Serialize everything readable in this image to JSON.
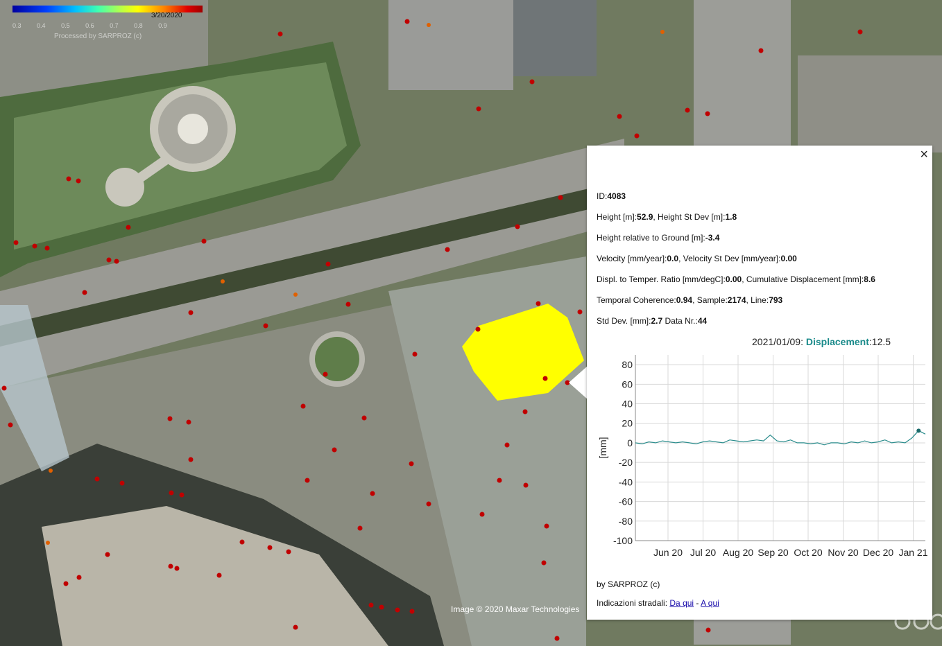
{
  "map": {
    "legend": {
      "date": "3/20/2020",
      "ticks": [
        "0.3",
        "0.4",
        "0.5",
        "0.6",
        "0.7",
        "0.8",
        "0.9"
      ],
      "credit": "Processed by SARPROZ (c)"
    },
    "copyright": "Image © 2020 Maxar Technologies",
    "selected_area_color": "#ffff00",
    "point_color": "#c00000",
    "logo": "Google Earth"
  },
  "popup": {
    "close_label": "×",
    "id_label": "ID:",
    "id": "4083",
    "height_label": "Height [m]:",
    "height": "52.9",
    "height_std_label": ", Height St Dev [m]:",
    "height_std": "1.8",
    "rel_ground_label": "Height relative to Ground [m]:",
    "rel_ground": "-3.4",
    "velocity_label": "Velocity [mm/year]:",
    "velocity": "0.0",
    "velocity_std_label": ", Velocity St Dev [mm/year]:",
    "velocity_std": "0.00",
    "displ_temp_label": "Displ. to Temper. Ratio [mm/degC]:",
    "displ_temp": "0.00",
    "cum_disp_label": ", Cumulative Displacement [mm]:",
    "cum_disp": "8.6",
    "coherence_label": "Temporal Coherence:",
    "coherence": "0.94",
    "sample_label": ", Sample:",
    "sample": "2174",
    "line_label": ", Line:",
    "line": "793",
    "std_dev_label": "Std Dev. [mm]:",
    "std_dev": "2.7",
    "data_nr_label": " Data Nr.:",
    "data_nr": "44",
    "chart_header_date": "2021/01/09: ",
    "chart_header_series": "Displacement",
    "chart_header_value": ":12.5",
    "credit": "by SARPROZ (c)",
    "directions_label": "Indicazioni stradali: ",
    "link_from": "Da qui",
    "link_sep": " - ",
    "link_to": "A qui"
  },
  "chart_data": {
    "type": "line",
    "ylabel": "[mm]",
    "ylim": [
      -100,
      90
    ],
    "yticks": [
      80,
      60,
      40,
      20,
      0,
      -20,
      -40,
      -60,
      -80,
      -100
    ],
    "xticks": [
      "Jun 20",
      "Jul 20",
      "Aug 20",
      "Sep 20",
      "Oct 20",
      "Nov 20",
      "Dec 20",
      "Jan 21"
    ],
    "grid": true,
    "series": [
      {
        "name": "Displacement",
        "color": "#2a8c8c",
        "values": [
          0,
          -1,
          1,
          0,
          2,
          1,
          0,
          1,
          0,
          -1,
          1,
          2,
          1,
          0,
          3,
          2,
          1,
          2,
          3,
          2,
          8,
          2,
          1,
          3,
          0,
          0,
          -1,
          0,
          -2,
          0,
          0,
          -1,
          1,
          0,
          2,
          0,
          1,
          3,
          0,
          1,
          0,
          5,
          12.5,
          9
        ]
      }
    ],
    "highlight_value": 12.5
  }
}
